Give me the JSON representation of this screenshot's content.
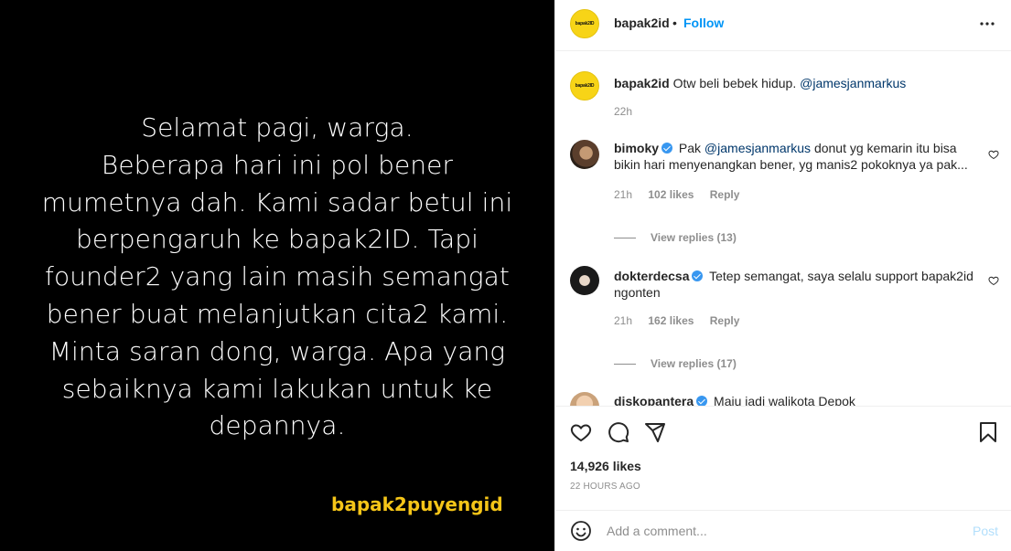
{
  "media": {
    "text": "Selamat pagi, warga.\nBeberapa hari ini pol bener\nmumetnya dah. Kami sadar betul ini\nberpengaruh ke bapak2ID. Tapi\nfounder2 yang lain masih semangat\nbener buat melanjutkan cita2 kami.\nMinta saran dong, warga. Apa yang\nsebaiknya kami lakukan untuk ke\ndepannya.",
    "watermark": "bapak2puyengid"
  },
  "header": {
    "avatar_text": "bapak2ID",
    "username": "bapak2id",
    "separator": "•",
    "follow_label": "Follow",
    "more_label": "•••"
  },
  "caption": {
    "username": "bapak2id",
    "text": "Otw beli bebek hidup.",
    "mention": "@jamesjanmarkus",
    "time": "22h"
  },
  "comments": [
    {
      "username": "bimoky",
      "prefix": "Pak",
      "mention": "@jamesjanmarkus",
      "text": "donut yg kemarin itu bisa bikin hari menyenangkan bener, yg manis2 pokoknya ya pak...",
      "time": "21h",
      "likes": "102 likes",
      "reply": "Reply",
      "view_replies": "View replies (13)"
    },
    {
      "username": "dokterdecsa",
      "text": "Tetep semangat, saya selalu support bapak2id ngonten",
      "time": "21h",
      "likes": "162 likes",
      "reply": "Reply",
      "view_replies": "View replies (17)"
    },
    {
      "username": "diskopantera",
      "text": "Maju jadi walikota Depok"
    }
  ],
  "stats": {
    "likes": "14,926 likes",
    "posted": "22 HOURS AGO"
  },
  "add_comment": {
    "placeholder": "Add a comment...",
    "post_label": "Post"
  },
  "icons": {
    "like": "heart-icon",
    "comment": "comment-icon",
    "share": "share-icon",
    "save": "bookmark-icon",
    "emoji": "emoji-icon",
    "more": "more-icon"
  }
}
